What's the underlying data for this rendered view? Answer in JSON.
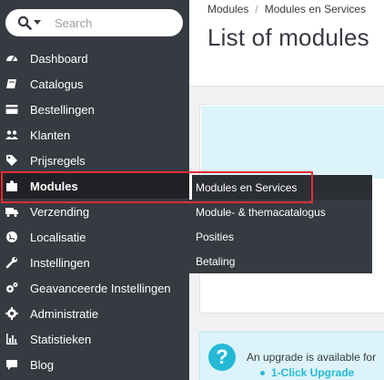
{
  "search": {
    "placeholder": "Search"
  },
  "sidebar": {
    "items": [
      {
        "label": "Dashboard",
        "icon": "dashboard-icon"
      },
      {
        "label": "Catalogus",
        "icon": "book-icon"
      },
      {
        "label": "Bestellingen",
        "icon": "credit-card-icon"
      },
      {
        "label": "Klanten",
        "icon": "users-icon"
      },
      {
        "label": "Prijsregels",
        "icon": "tags-icon"
      },
      {
        "label": "Modules",
        "icon": "puzzle-icon"
      },
      {
        "label": "Verzending",
        "icon": "truck-icon"
      },
      {
        "label": "Localisatie",
        "icon": "globe-icon"
      },
      {
        "label": "Instellingen",
        "icon": "wrench-icon"
      },
      {
        "label": "Geavanceerde Instellingen",
        "icon": "cogs-icon"
      },
      {
        "label": "Administratie",
        "icon": "gear-icon"
      },
      {
        "label": "Statistieken",
        "icon": "bar-chart-icon"
      },
      {
        "label": "Blog",
        "icon": "comment-icon"
      }
    ],
    "active_item": "Modules"
  },
  "submenu": {
    "items": [
      {
        "label": "Modules en Services"
      },
      {
        "label": "Module- & themacatalogus"
      },
      {
        "label": "Posities"
      },
      {
        "label": "Betaling"
      }
    ],
    "current_item": "Modules en Services"
  },
  "header": {
    "breadcrumb": [
      "Modules",
      "Modules en Services"
    ],
    "title": "List of modules"
  },
  "alert": {
    "text": "An upgrade is available for",
    "link": "1-Click Upgrade"
  },
  "colors": {
    "sidebar_bg": "#363a41",
    "highlight_outline": "#e02d32",
    "info_bg": "#dcf4f9",
    "accent": "#25b9d7"
  }
}
